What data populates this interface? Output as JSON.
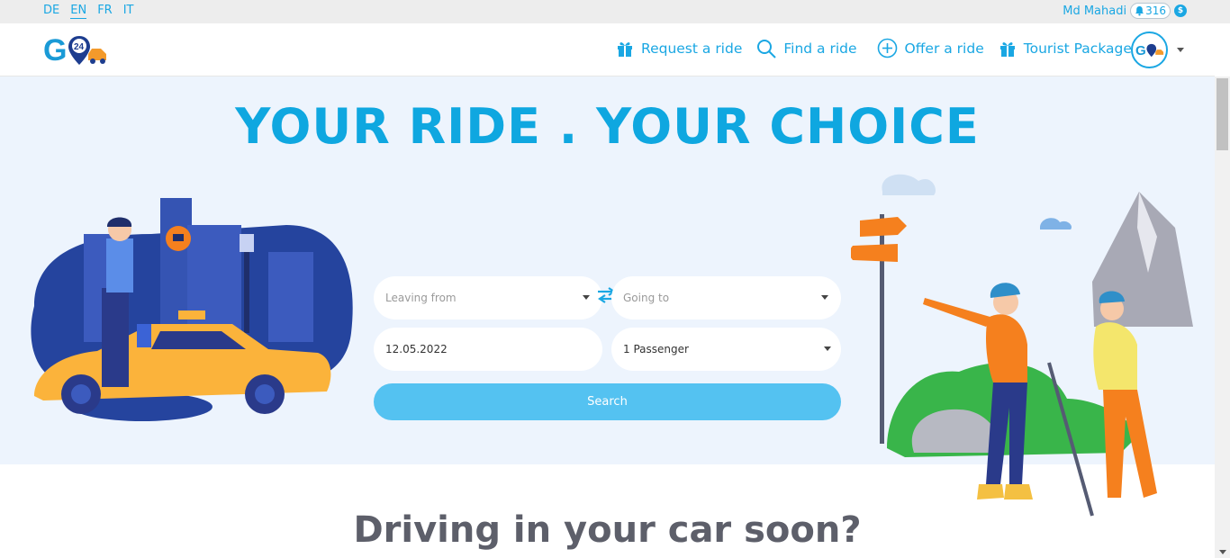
{
  "languages": [
    "DE",
    "EN",
    "FR",
    "IT"
  ],
  "active_language": "EN",
  "user": {
    "name": "Md Mahadi",
    "notifications": "316",
    "coin_symbol": "$"
  },
  "nav": {
    "request_ride": "Request a ride",
    "find_ride": "Find a ride",
    "offer_ride": "Offer a ride",
    "tourist_package": "Tourist Package"
  },
  "hero": {
    "title": "YOUR RIDE . YOUR CHOICE"
  },
  "search": {
    "leaving_from": "Leaving from",
    "going_to": "Going to",
    "date": "12.05.2022",
    "passengers": "1 Passenger",
    "button": "Search"
  },
  "section": {
    "title": "Driving in your car soon?"
  },
  "colors": {
    "accent": "#1aa7e3",
    "button": "#54c2f1",
    "hero_bg": "#edf4fd"
  }
}
